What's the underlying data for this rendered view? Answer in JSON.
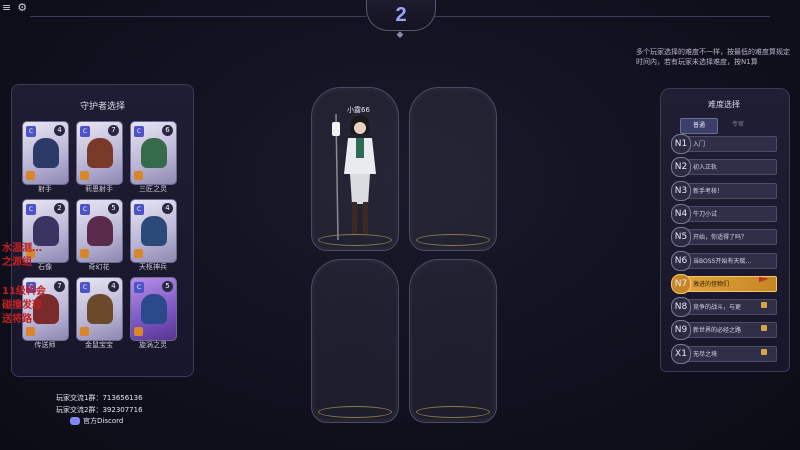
{
  "top": {
    "round_number": "2"
  },
  "notice": "多个玩家选择的难度不一样，按最低的难度算规定时间内，若有玩家未选择难度，按N1算",
  "guardian_panel": {
    "title": "守护者选择",
    "cards": [
      {
        "name": "射手",
        "cost": "4",
        "art_color": "#2c3a68"
      },
      {
        "name": "莉恩射手",
        "cost": "7",
        "art_color": "#7a3a2a"
      },
      {
        "name": "三匠之灵",
        "cost": "6",
        "art_color": "#356a4a"
      },
      {
        "name": "石像",
        "cost": "2",
        "art_color": "#3a3560"
      },
      {
        "name": "奇幻花",
        "cost": "5",
        "art_color": "#5a2a4a"
      },
      {
        "name": "天枢神兵",
        "cost": "4",
        "art_color": "#2b4a7a"
      },
      {
        "name": "传送师",
        "cost": "7",
        "art_color": "#7a2a2a"
      },
      {
        "name": "金鼠宝宝",
        "cost": "4",
        "art_color": "#6a4a2a"
      },
      {
        "name": "旋涡之灵",
        "cost": "5",
        "art_color": "#2a4a8a"
      }
    ]
  },
  "contacts": {
    "group1": "玩家交流1群：713656136",
    "group2": "玩家交流2群：392307716",
    "discord": "官方Discord"
  },
  "player": {
    "name": "小露66"
  },
  "overlay": {
    "line1": "水温测…",
    "line2": "之源组",
    "line3": "11级科会",
    "line4": "碰撞发现",
    "line5": "送将路"
  },
  "difficulty_panel": {
    "title": "难度选择",
    "tabs": [
      "普通",
      "专家"
    ],
    "items": [
      {
        "id": "N1",
        "label": "入门",
        "locked": false,
        "selected": false
      },
      {
        "id": "N2",
        "label": "初入正轨",
        "locked": false,
        "selected": false
      },
      {
        "id": "N3",
        "label": "新手考核！",
        "locked": false,
        "selected": false
      },
      {
        "id": "N4",
        "label": "牛刀小试",
        "locked": false,
        "selected": false
      },
      {
        "id": "N5",
        "label": "开始，你适得了吗？",
        "locked": false,
        "selected": false
      },
      {
        "id": "N6",
        "label": "当BOSS开始有天赋…",
        "locked": false,
        "selected": false
      },
      {
        "id": "N7",
        "label": "激进的怪物们",
        "locked": false,
        "selected": true
      },
      {
        "id": "N8",
        "label": "竞争的战斗，与更",
        "locked": true,
        "selected": false
      },
      {
        "id": "N9",
        "label": "新世界的必经之路",
        "locked": true,
        "selected": false
      },
      {
        "id": "X1",
        "label": "无尽之境",
        "locked": true,
        "selected": false
      }
    ]
  },
  "colors": {
    "accent": "#9da3ff",
    "selected": "#e0a63e",
    "danger": "#c02020"
  }
}
